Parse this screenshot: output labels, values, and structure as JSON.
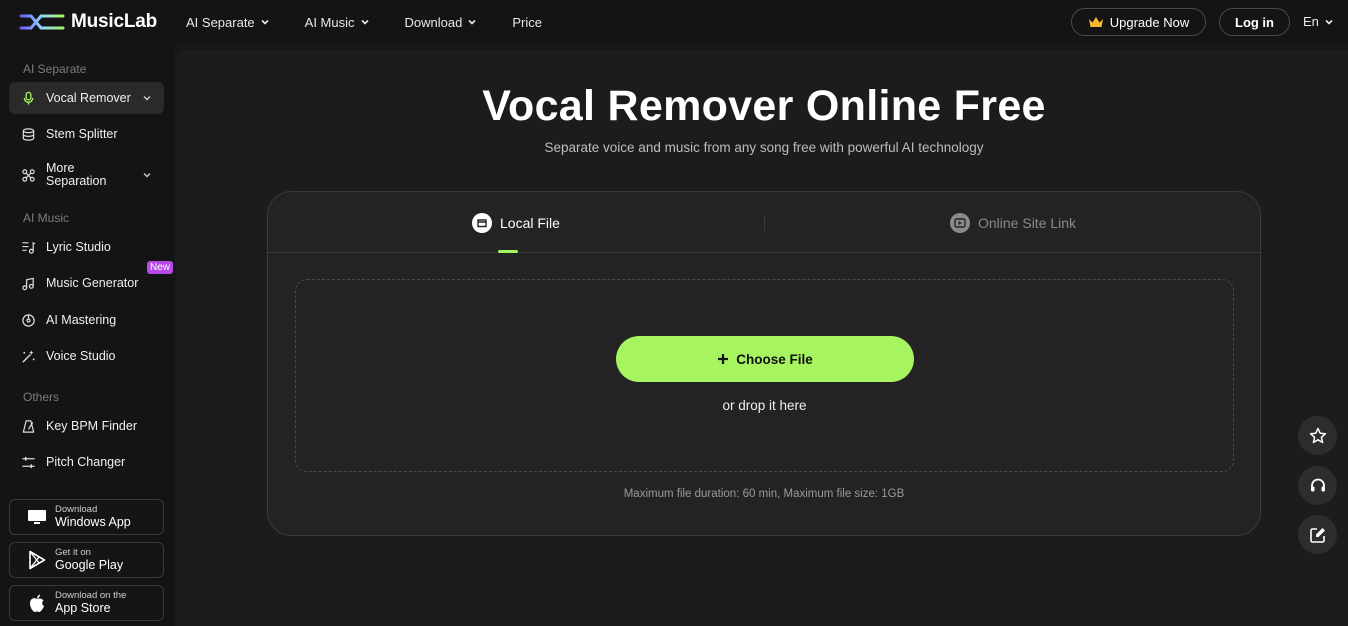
{
  "brand": {
    "name": "MusicLab"
  },
  "nav": {
    "items": [
      {
        "label": "AI Separate",
        "has_dropdown": true
      },
      {
        "label": "AI Music",
        "has_dropdown": true
      },
      {
        "label": "Download",
        "has_dropdown": true
      },
      {
        "label": "Price",
        "has_dropdown": false
      }
    ],
    "upgrade_label": "Upgrade Now",
    "login_label": "Log in",
    "language": "En"
  },
  "sidebar": {
    "sections": [
      {
        "title": "AI Separate",
        "items": [
          {
            "label": "Vocal Remover",
            "icon": "microphone-icon",
            "active": true,
            "expandable": true
          },
          {
            "label": "Stem Splitter",
            "icon": "stack-icon",
            "active": false
          },
          {
            "label": "More Separation",
            "icon": "network-icon",
            "active": false,
            "expandable": true
          }
        ]
      },
      {
        "title": "AI Music",
        "items": [
          {
            "label": "Lyric Studio",
            "icon": "lyric-icon"
          },
          {
            "label": "Music Generator",
            "icon": "music-note-icon",
            "badge": "New"
          },
          {
            "label": "AI Mastering",
            "icon": "disc-icon"
          },
          {
            "label": "Voice Studio",
            "icon": "magic-wand-icon"
          }
        ]
      },
      {
        "title": "Others",
        "items": [
          {
            "label": "Key BPM Finder",
            "icon": "metronome-icon"
          },
          {
            "label": "Pitch Changer",
            "icon": "sliders-icon"
          }
        ]
      }
    ],
    "store_buttons": [
      {
        "small": "Download",
        "big": "Windows App",
        "icon": "monitor-icon"
      },
      {
        "small": "Get it on",
        "big": "Google Play",
        "icon": "google-play-icon"
      },
      {
        "small": "Download on the",
        "big": "App Store",
        "icon": "apple-icon"
      }
    ]
  },
  "main": {
    "title": "Vocal Remover Online Free",
    "subtitle": "Separate voice and music from any song free with powerful AI technology",
    "tabs": [
      {
        "label": "Local File",
        "active": true
      },
      {
        "label": "Online Site Link",
        "active": false
      }
    ],
    "choose_file_label": "Choose File",
    "drop_text": "or drop it here",
    "limits_text": "Maximum file duration: 60 min, Maximum file size: 1GB"
  },
  "colors": {
    "accent": "#a6f45f",
    "background": "#171717",
    "panel": "#232323",
    "badge": "#b649e8"
  }
}
